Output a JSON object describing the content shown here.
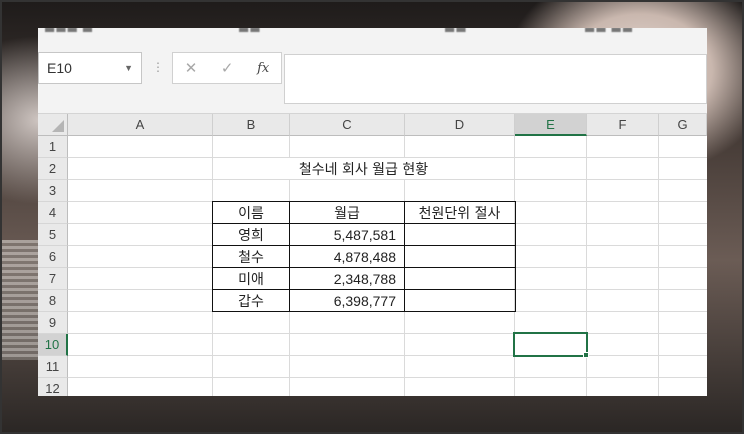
{
  "name_box": {
    "value": "E10"
  },
  "formula_buttons": {
    "cancel": "✕",
    "enter": "✓",
    "fx": "fx"
  },
  "columns": [
    "A",
    "B",
    "C",
    "D",
    "E",
    "F",
    "G"
  ],
  "active_column": "E",
  "rows": [
    "1",
    "2",
    "3",
    "4",
    "5",
    "6",
    "7",
    "8",
    "9",
    "10",
    "11",
    "12"
  ],
  "active_row": "10",
  "sheet": {
    "title": "철수네 회사 월급 현황",
    "headers": [
      "이름",
      "월급",
      "천원단위 절사"
    ],
    "records": [
      {
        "name": "영희",
        "salary": "5,487,581",
        "truncated": ""
      },
      {
        "name": "철수",
        "salary": "4,878,488",
        "truncated": ""
      },
      {
        "name": "미애",
        "salary": "2,348,788",
        "truncated": ""
      },
      {
        "name": "갑수",
        "salary": "6,398,777",
        "truncated": ""
      }
    ]
  },
  "colors": {
    "accent": "#217346",
    "header_bg": "#e9e9e9"
  }
}
